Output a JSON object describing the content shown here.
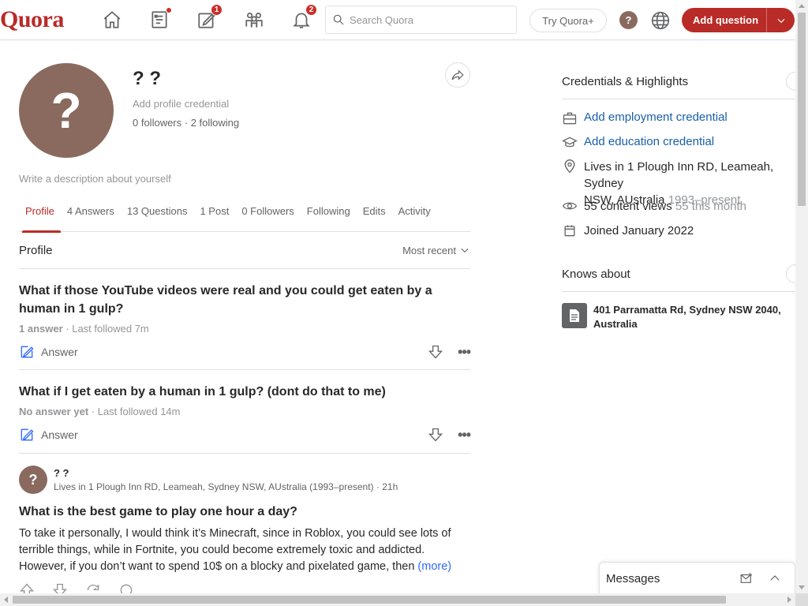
{
  "header": {
    "logo": "Quora",
    "notifications": {
      "following_badge": "",
      "write_badge": "1",
      "bell_badge": "2"
    },
    "search": {
      "placeholder": "Search Quora"
    },
    "try_plus_label": "Try Quora+",
    "help_label": "?",
    "add_question_label": "Add question",
    "nav_icons": [
      "home-icon",
      "following-icon",
      "answer-icon",
      "spaces-icon",
      "notifications-icon"
    ],
    "brand_color": "#b92b27"
  },
  "profile": {
    "avatar_letter": "?",
    "name": "? ?",
    "credential_placeholder": "Add profile credential",
    "follow_stats": "0 followers · 2 following",
    "description_placeholder": "Write a description about yourself"
  },
  "tabs": [
    {
      "label": "Profile",
      "active": true
    },
    {
      "label": "4 Answers"
    },
    {
      "label": "13 Questions"
    },
    {
      "label": "1 Post"
    },
    {
      "label": "0 Followers"
    },
    {
      "label": "Following"
    },
    {
      "label": "Edits"
    },
    {
      "label": "Activity"
    }
  ],
  "section": {
    "title": "Profile",
    "sort_label": "Most recent"
  },
  "questions": [
    {
      "title": "What if those YouTube videos were real and you could get eaten by a human in 1 gulp?",
      "answers": "1 answer",
      "followed": " · Last followed 7m",
      "answer_label": "Answer"
    },
    {
      "title": "What if I get eaten by a human in 1 gulp? (dont do that to me)",
      "answers": "No answer yet",
      "followed": " · Last followed 14m",
      "answer_label": "Answer"
    }
  ],
  "post": {
    "avatar_letter": "?",
    "author": "? ?",
    "subline": "Lives in 1 Plough Inn RD, Leameah, Sydney NSW, AUstralia (1993–present) · 21h",
    "title": "What is the best game to play one hour a day?",
    "body": "To take it personally, I would think it’s Minecraft, since in Roblox, you could see lots of terrible things, while in Fortnite, you could become extremely toxic and addicted. However, if you don’t want to spend 10$ on a blocky and pixelated game, then",
    "more_label": "(more)"
  },
  "sidebar": {
    "credentials_title": "Credentials & Highlights",
    "employment_label": "Add employment credential",
    "education_label": "Add education credential",
    "location_line1": "Lives in 1 Plough Inn RD, Leameah, Sydney",
    "location_line2": "NSW, AUstralia",
    "location_years": "1993–present",
    "views": "55 content views",
    "views_month": "55 this month",
    "joined": "Joined January 2022",
    "knows_title": "Knows about",
    "knows_item": "401 Parramatta Rd, Sydney NSW 2040, Australia"
  },
  "messages": {
    "label": "Messages"
  },
  "colors": {
    "link": "#195faa",
    "accent_blue": "#2e69ff",
    "muted": "#939598",
    "avatar_bg": "#8a6a5f"
  }
}
